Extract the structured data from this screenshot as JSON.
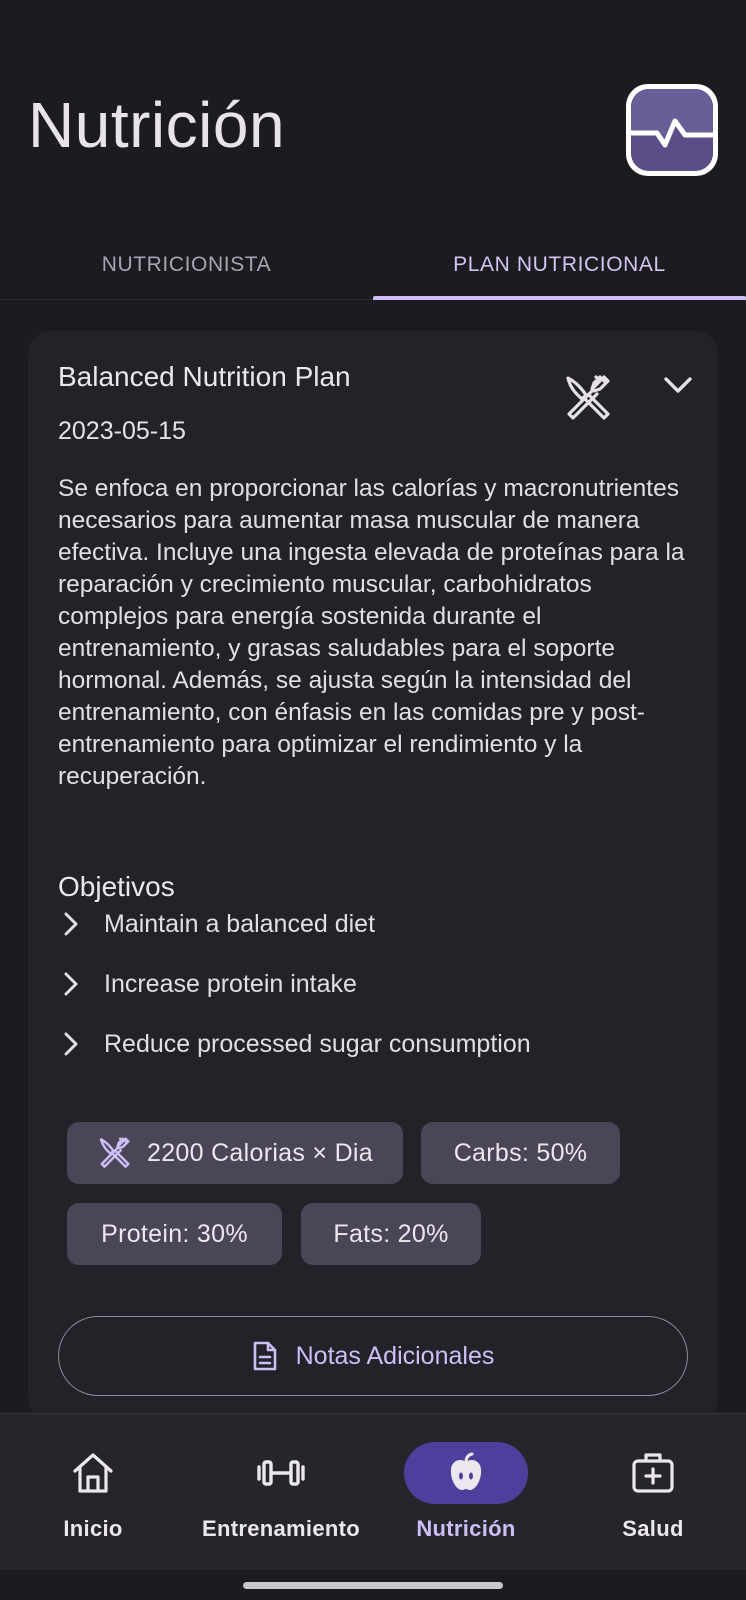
{
  "header": {
    "title": "Nutrición",
    "app_icon": "health-pulse-icon"
  },
  "tabs": [
    {
      "label": "NUTRICIONISTA",
      "selected": false
    },
    {
      "label": "PLAN NUTRICIONAL",
      "selected": true
    }
  ],
  "plan": {
    "name": "Balanced Nutrition Plan",
    "date": "2023-05-15",
    "description": "Se enfoca en proporcionar las calorías y macronutrientes necesarios para aumentar masa muscular de manera efectiva. Incluye una ingesta elevada de proteínas para la reparación y crecimiento muscular, carbohidratos complejos para energía sostenida durante el entrenamiento, y grasas saludables para el soporte hormonal. Además, se ajusta según la intensidad del entrenamiento, con énfasis en las comidas pre y post-entrenamiento para optimizar el rendimiento y la recuperación.",
    "objectives_title": "Objetivos",
    "objectives": [
      "Maintain a balanced diet",
      "Increase protein intake",
      "Reduce processed sugar consumption"
    ],
    "chips": {
      "calories": "2200 Calorias × Dia",
      "carbs": "Carbs: 50%",
      "protein": "Protein: 30%",
      "fats": "Fats: 20%"
    },
    "notes_button": "Notas Adicionales"
  },
  "bottom_nav": [
    {
      "label": "Inicio",
      "icon": "home-icon",
      "active": false
    },
    {
      "label": "Entrenamiento",
      "icon": "dumbbell-icon",
      "active": false
    },
    {
      "label": "Nutrición",
      "icon": "apple-icon",
      "active": true
    },
    {
      "label": "Salud",
      "icon": "medical-kit-icon",
      "active": false
    }
  ],
  "colors": {
    "background": "#1c1b20",
    "card": "#232228",
    "accent": "#cdbef6",
    "active_pill": "#4e3f9c",
    "chip": "#4a4658"
  }
}
